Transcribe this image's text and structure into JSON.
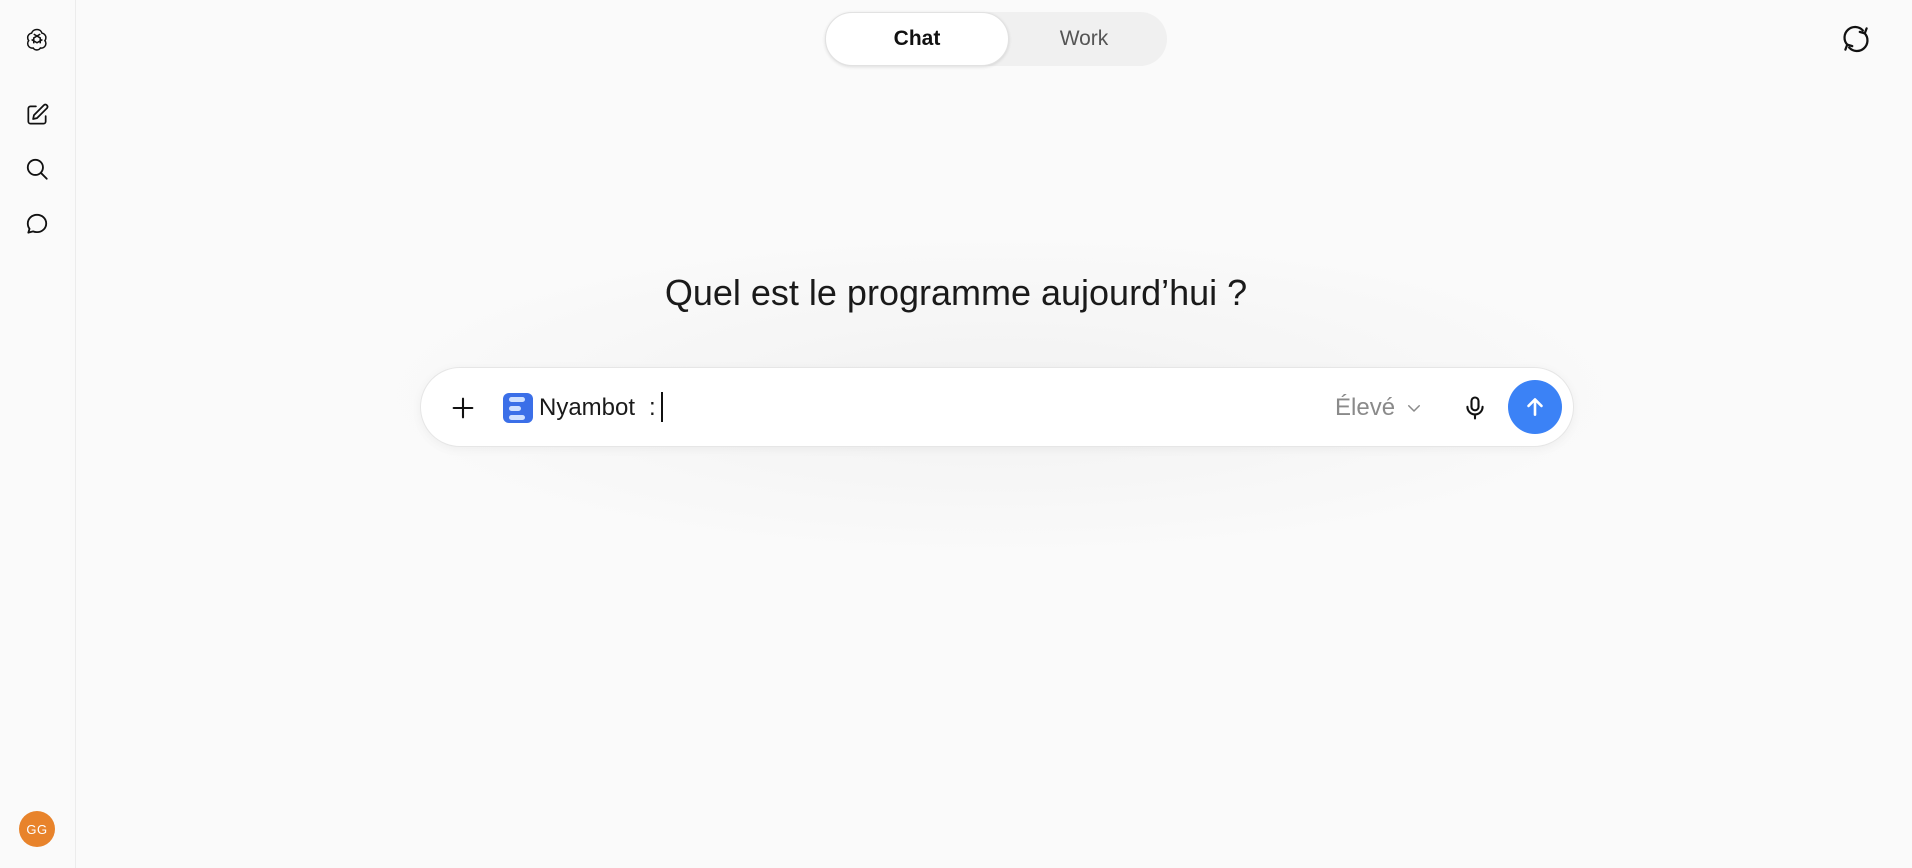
{
  "sidebar": {
    "logo_icon": "openai-logo-icon",
    "items": [
      {
        "name": "new-chat",
        "icon": "compose-icon"
      },
      {
        "name": "search",
        "icon": "search-icon"
      },
      {
        "name": "chats",
        "icon": "chat-bubble-icon"
      }
    ],
    "avatar_initials": "GG",
    "avatar_color": "#e8832b"
  },
  "header": {
    "tabs": [
      {
        "label": "Chat",
        "active": true
      },
      {
        "label": "Work",
        "active": false
      }
    ],
    "right_icon": "refresh-chat-icon"
  },
  "main": {
    "headline": "Quel est le programme aujourd’hui ?"
  },
  "composer": {
    "gpt_name": "Nyambot",
    "input_value": ":",
    "level_label": "Élevé",
    "accent_color": "#3b82f6",
    "gpt_icon_color": "#3b6fe8"
  }
}
